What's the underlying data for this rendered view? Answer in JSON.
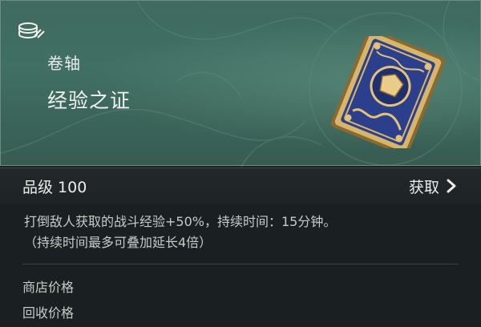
{
  "header": {
    "category": "卷轴",
    "item_name": "经验之证",
    "category_icon": "coins-icon",
    "item_art": "experience-card-icon"
  },
  "grade_bar": {
    "grade": "品级 100",
    "obtain_label": "获取",
    "obtain_icon": "chevron-right-icon"
  },
  "description": {
    "line1": "打倒敌人获取的战斗经验+50%，持续时间：15分钟。",
    "line2": "（持续时间最多可叠加延长4倍）"
  },
  "prices": {
    "shop_label": "商店价格",
    "recycle_label": "回收价格"
  },
  "colors": {
    "header_green": "#416f63",
    "card_blue": "#2c3f8c",
    "card_gold": "#c9a45a"
  }
}
